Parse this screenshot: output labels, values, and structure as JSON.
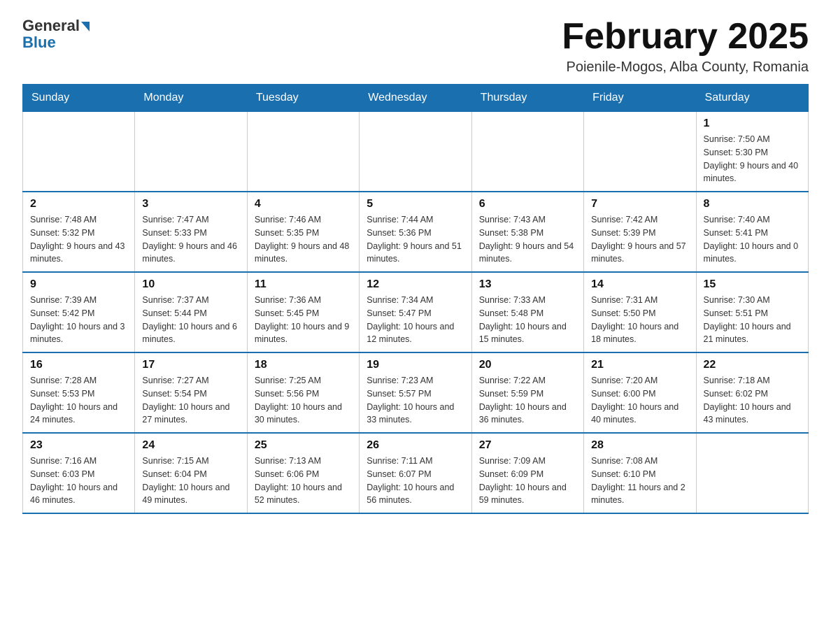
{
  "logo": {
    "general": "General",
    "blue": "Blue"
  },
  "title": "February 2025",
  "subtitle": "Poienile-Mogos, Alba County, Romania",
  "weekdays": [
    "Sunday",
    "Monday",
    "Tuesday",
    "Wednesday",
    "Thursday",
    "Friday",
    "Saturday"
  ],
  "weeks": [
    [
      {
        "day": "",
        "info": ""
      },
      {
        "day": "",
        "info": ""
      },
      {
        "day": "",
        "info": ""
      },
      {
        "day": "",
        "info": ""
      },
      {
        "day": "",
        "info": ""
      },
      {
        "day": "",
        "info": ""
      },
      {
        "day": "1",
        "info": "Sunrise: 7:50 AM\nSunset: 5:30 PM\nDaylight: 9 hours and 40 minutes."
      }
    ],
    [
      {
        "day": "2",
        "info": "Sunrise: 7:48 AM\nSunset: 5:32 PM\nDaylight: 9 hours and 43 minutes."
      },
      {
        "day": "3",
        "info": "Sunrise: 7:47 AM\nSunset: 5:33 PM\nDaylight: 9 hours and 46 minutes."
      },
      {
        "day": "4",
        "info": "Sunrise: 7:46 AM\nSunset: 5:35 PM\nDaylight: 9 hours and 48 minutes."
      },
      {
        "day": "5",
        "info": "Sunrise: 7:44 AM\nSunset: 5:36 PM\nDaylight: 9 hours and 51 minutes."
      },
      {
        "day": "6",
        "info": "Sunrise: 7:43 AM\nSunset: 5:38 PM\nDaylight: 9 hours and 54 minutes."
      },
      {
        "day": "7",
        "info": "Sunrise: 7:42 AM\nSunset: 5:39 PM\nDaylight: 9 hours and 57 minutes."
      },
      {
        "day": "8",
        "info": "Sunrise: 7:40 AM\nSunset: 5:41 PM\nDaylight: 10 hours and 0 minutes."
      }
    ],
    [
      {
        "day": "9",
        "info": "Sunrise: 7:39 AM\nSunset: 5:42 PM\nDaylight: 10 hours and 3 minutes."
      },
      {
        "day": "10",
        "info": "Sunrise: 7:37 AM\nSunset: 5:44 PM\nDaylight: 10 hours and 6 minutes."
      },
      {
        "day": "11",
        "info": "Sunrise: 7:36 AM\nSunset: 5:45 PM\nDaylight: 10 hours and 9 minutes."
      },
      {
        "day": "12",
        "info": "Sunrise: 7:34 AM\nSunset: 5:47 PM\nDaylight: 10 hours and 12 minutes."
      },
      {
        "day": "13",
        "info": "Sunrise: 7:33 AM\nSunset: 5:48 PM\nDaylight: 10 hours and 15 minutes."
      },
      {
        "day": "14",
        "info": "Sunrise: 7:31 AM\nSunset: 5:50 PM\nDaylight: 10 hours and 18 minutes."
      },
      {
        "day": "15",
        "info": "Sunrise: 7:30 AM\nSunset: 5:51 PM\nDaylight: 10 hours and 21 minutes."
      }
    ],
    [
      {
        "day": "16",
        "info": "Sunrise: 7:28 AM\nSunset: 5:53 PM\nDaylight: 10 hours and 24 minutes."
      },
      {
        "day": "17",
        "info": "Sunrise: 7:27 AM\nSunset: 5:54 PM\nDaylight: 10 hours and 27 minutes."
      },
      {
        "day": "18",
        "info": "Sunrise: 7:25 AM\nSunset: 5:56 PM\nDaylight: 10 hours and 30 minutes."
      },
      {
        "day": "19",
        "info": "Sunrise: 7:23 AM\nSunset: 5:57 PM\nDaylight: 10 hours and 33 minutes."
      },
      {
        "day": "20",
        "info": "Sunrise: 7:22 AM\nSunset: 5:59 PM\nDaylight: 10 hours and 36 minutes."
      },
      {
        "day": "21",
        "info": "Sunrise: 7:20 AM\nSunset: 6:00 PM\nDaylight: 10 hours and 40 minutes."
      },
      {
        "day": "22",
        "info": "Sunrise: 7:18 AM\nSunset: 6:02 PM\nDaylight: 10 hours and 43 minutes."
      }
    ],
    [
      {
        "day": "23",
        "info": "Sunrise: 7:16 AM\nSunset: 6:03 PM\nDaylight: 10 hours and 46 minutes."
      },
      {
        "day": "24",
        "info": "Sunrise: 7:15 AM\nSunset: 6:04 PM\nDaylight: 10 hours and 49 minutes."
      },
      {
        "day": "25",
        "info": "Sunrise: 7:13 AM\nSunset: 6:06 PM\nDaylight: 10 hours and 52 minutes."
      },
      {
        "day": "26",
        "info": "Sunrise: 7:11 AM\nSunset: 6:07 PM\nDaylight: 10 hours and 56 minutes."
      },
      {
        "day": "27",
        "info": "Sunrise: 7:09 AM\nSunset: 6:09 PM\nDaylight: 10 hours and 59 minutes."
      },
      {
        "day": "28",
        "info": "Sunrise: 7:08 AM\nSunset: 6:10 PM\nDaylight: 11 hours and 2 minutes."
      },
      {
        "day": "",
        "info": ""
      }
    ]
  ]
}
